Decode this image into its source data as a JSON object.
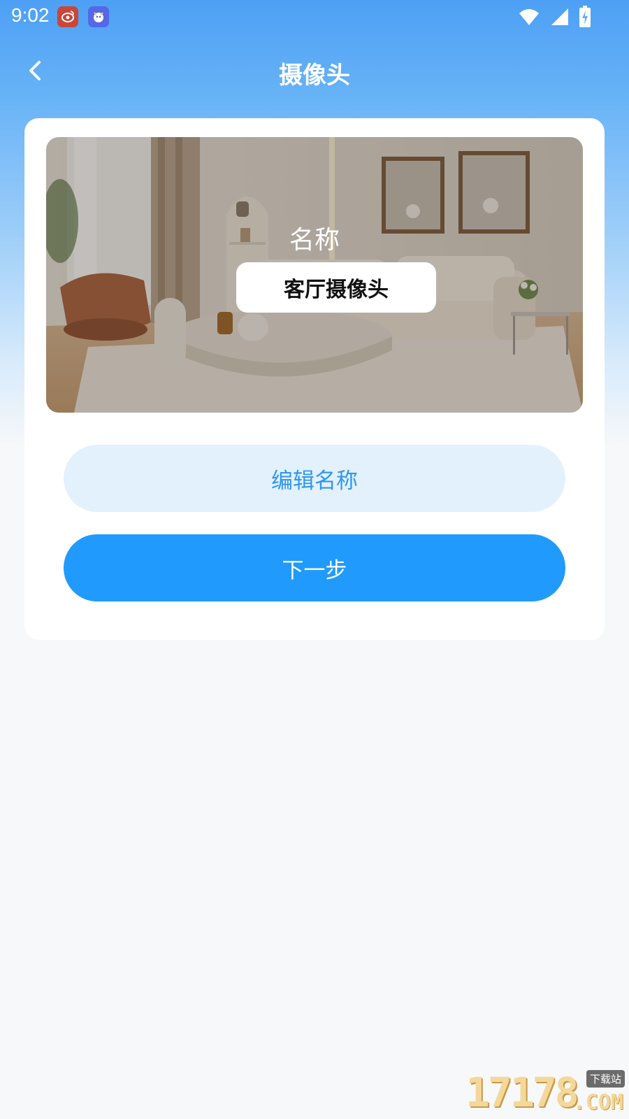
{
  "status_bar": {
    "time": "9:02",
    "icons": [
      "weibo-app-icon",
      "bird-app-icon",
      "wifi-icon",
      "signal-icon",
      "battery-charging-icon"
    ]
  },
  "header": {
    "title": "摄像头",
    "back_icon": "chevron-left-icon"
  },
  "preview": {
    "name_label": "名称",
    "device_name": "客厅摄像头",
    "image": "living-room-photo"
  },
  "actions": {
    "edit_name_label": "编辑名称",
    "next_label": "下一步"
  },
  "watermark": {
    "number": "17178",
    "badge": "下载站",
    "domain": ".COM"
  },
  "colors": {
    "header_gradient_top": "#4da0f5",
    "primary_button": "#209bfd",
    "secondary_button_bg": "#e3f1fd",
    "secondary_button_text": "#2f97f0",
    "page_background": "#f7f8fa"
  }
}
